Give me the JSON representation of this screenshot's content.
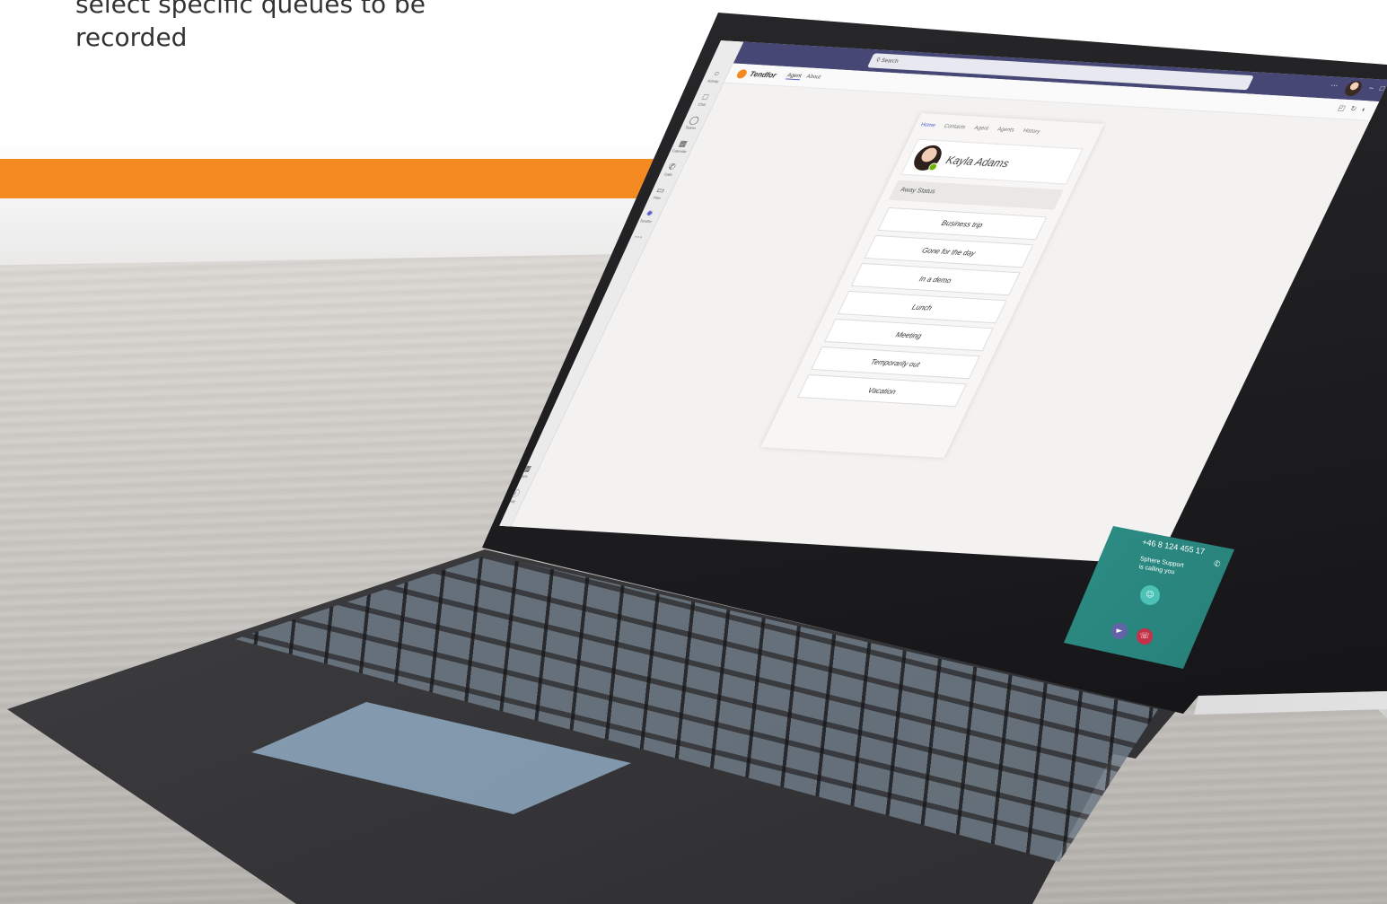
{
  "caption": {
    "line1": "select specific queues to be",
    "line2": "recorded"
  },
  "colors": {
    "accent": "#f58a23",
    "teams_purple": "#464775",
    "presence_available": "#6bb700",
    "call_background": "#2c8c84",
    "decline": "#c4314b"
  },
  "teams": {
    "search_placeholder": "Search",
    "rail": [
      {
        "label": "Activity",
        "icon": "bell-icon"
      },
      {
        "label": "Chat",
        "icon": "chat-icon"
      },
      {
        "label": "Teams",
        "icon": "teams-icon"
      },
      {
        "label": "Calendar",
        "icon": "calendar-icon"
      },
      {
        "label": "Calls",
        "icon": "phone-icon"
      },
      {
        "label": "Files",
        "icon": "file-icon"
      },
      {
        "label": "Tendfor",
        "icon": "tendfor-icon"
      },
      {
        "label": "Apps",
        "icon": "apps-icon"
      },
      {
        "label": "Help",
        "icon": "help-icon"
      }
    ],
    "app": {
      "name": "Tendfor",
      "tabs": [
        "Agent",
        "About"
      ]
    }
  },
  "panel": {
    "tabs": [
      "Home",
      "Contacts",
      "Agent",
      "Agents",
      "History"
    ],
    "user_name": "Kayla Adams",
    "away_header": "Away Status",
    "statuses": [
      "Business trip",
      "Gone for the day",
      "In a demo",
      "Lunch",
      "Meeting",
      "Temporarily out",
      "Vacation"
    ]
  },
  "call": {
    "number": "+46 8 124 455 17",
    "caller": "Sphere Support",
    "subtitle": "is calling you"
  }
}
